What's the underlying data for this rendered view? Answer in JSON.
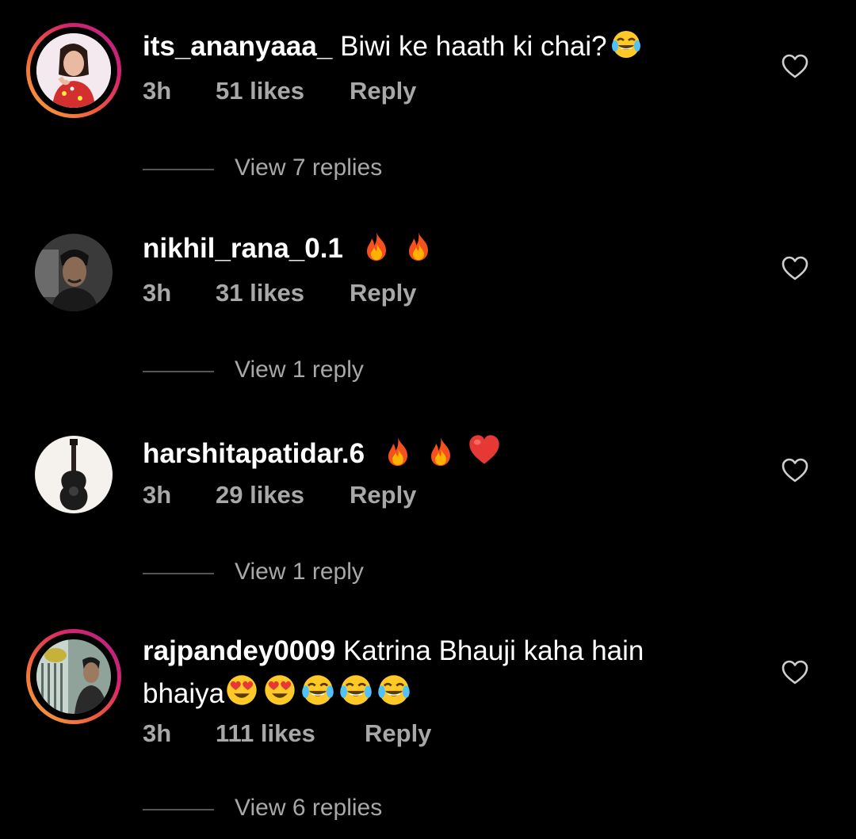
{
  "comments": [
    {
      "username": "its_ananyaaa_",
      "text": "Biwi ke haath ki chai?",
      "emojis": [
        "joy"
      ],
      "time": "3h",
      "likes": "51 likes",
      "reply_label": "Reply",
      "view_replies": "View 7 replies",
      "has_story": true
    },
    {
      "username": "nikhil_rana_0.1",
      "text": "",
      "emojis": [
        "fire",
        "fire"
      ],
      "time": "3h",
      "likes": "31 likes",
      "reply_label": "Reply",
      "view_replies": "View 1 reply",
      "has_story": false
    },
    {
      "username": "harshitapatidar.6",
      "text": "",
      "emojis": [
        "fire",
        "fire",
        "red-heart"
      ],
      "time": "3h",
      "likes": "29 likes",
      "reply_label": "Reply",
      "view_replies": "View 1 reply",
      "has_story": false
    },
    {
      "username": "rajpandey0009",
      "text": "Katrina Bhauji kaha hain",
      "text_line2": "bhaiya",
      "emojis": [
        "heart-eyes",
        "heart-eyes",
        "joy",
        "joy",
        "joy"
      ],
      "time": "3h",
      "likes": "111 likes",
      "reply_label": "Reply",
      "view_replies": "View 6 replies",
      "has_story": true
    }
  ],
  "colors": {
    "background": "#000000",
    "text_primary": "#ffffff",
    "text_secondary": "#a8a8a8"
  },
  "icons": [
    "heart-outline-icon",
    "joy-emoji-icon",
    "fire-emoji-icon",
    "red-heart-emoji-icon",
    "heart-eyes-emoji-icon"
  ]
}
